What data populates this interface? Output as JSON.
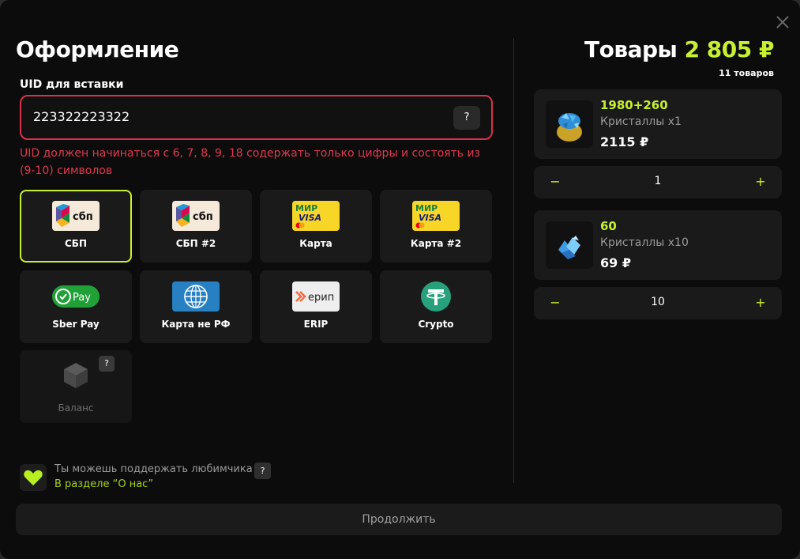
{
  "checkout": {
    "title": "Оформление",
    "uid_label": "UID для вставки",
    "uid_value": "223322223322",
    "uid_help": "?",
    "uid_error": "UID должен начинаться с 6, 7, 8, 9, 18 содержать только цифры и состоять из (9-10) символов"
  },
  "payment_methods": [
    {
      "label": "СБП",
      "selected": true
    },
    {
      "label": "СБП #2"
    },
    {
      "label": "Карта"
    },
    {
      "label": "Карта #2"
    },
    {
      "label": "Sber Pay"
    },
    {
      "label": "Карта не РФ"
    },
    {
      "label": "ERIP"
    },
    {
      "label": "Crypto"
    }
  ],
  "logo_texts": {
    "sbp": "сбп",
    "mir": "МИР",
    "visa": "VISA",
    "sber": "Pay",
    "erip": "ерип"
  },
  "balance": {
    "label": "Баланс",
    "help": "?"
  },
  "support": {
    "text": "Ты можешь поддержать любимчика",
    "link": "В разделе “О нас”",
    "help": "?"
  },
  "goods": {
    "title": "Товары",
    "total": "2 805 ₽",
    "count": "11 товаров",
    "items": [
      {
        "amount": "1980+260",
        "name": "Кристаллы x1",
        "price": "2115 ₽",
        "qty": "1"
      },
      {
        "amount": "60",
        "name": "Кристаллы x10",
        "price": "69 ₽",
        "qty": "10"
      }
    ],
    "minus": "−",
    "plus": "+"
  },
  "continue_label": "Продолжить",
  "colors": {
    "accent": "#c8f032",
    "error": "#e0384f",
    "background": "#0c0c0c",
    "card": "#1a1a1a"
  }
}
